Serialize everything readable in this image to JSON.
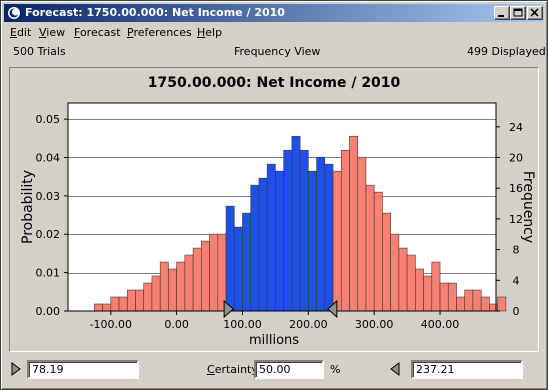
{
  "window": {
    "title": "Forecast: 1750.00.000: Net Income / 2010",
    "controls": [
      "minimize-icon",
      "maximize-icon",
      "close-icon"
    ]
  },
  "menu": {
    "edit": {
      "first": "E",
      "rest": "dit"
    },
    "view": {
      "first": "V",
      "rest": "iew"
    },
    "forecast": {
      "first": "F",
      "rest": "orecast"
    },
    "preferences": {
      "first": "P",
      "rest": "references"
    },
    "help": {
      "first": "H",
      "rest": "elp"
    }
  },
  "info": {
    "trials": "500 Trials",
    "view_name": "Frequency View",
    "displayed": "499 Displayed"
  },
  "certainty": {
    "left_value": "78.19",
    "label_first": "C",
    "label_rest": "ertainty:",
    "value": "50.00",
    "unit": "%",
    "right_value": "237.21"
  },
  "colors": {
    "in_range": "#1e4fe6",
    "out_range": "#f98073",
    "plot_bg": "#ffffff",
    "marker": "#909090"
  },
  "chart_data": {
    "type": "bar",
    "title": "1750.00.000: Net Income / 2010",
    "xlabel": "millions",
    "ylabel": "Probability",
    "y2label": "Frequency",
    "xlim": [
      -165,
      485
    ],
    "ylim": [
      0,
      0.0542
    ],
    "y2lim": [
      0,
      27.1
    ],
    "xticks": [
      -100,
      0,
      100,
      200,
      300,
      400
    ],
    "xtick_labels": [
      "-100.00",
      "0.00",
      "100.00",
      "200.00",
      "300.00",
      "400.00"
    ],
    "yticks": [
      0,
      0.01,
      0.02,
      0.03,
      0.04,
      0.05
    ],
    "ytick_labels": [
      "0.00",
      "0.01",
      "0.02",
      "0.03",
      "0.04",
      "0.05"
    ],
    "y2ticks": [
      0,
      4,
      8,
      12,
      16,
      20,
      24
    ],
    "y2tick_labels": [
      "0",
      "4",
      "8",
      "12",
      "16",
      "20",
      "24"
    ],
    "grid": true,
    "bin_start": -125,
    "bin_width": 12.5,
    "frequencies": [
      1,
      1,
      2,
      2,
      3,
      3,
      4,
      5,
      7,
      6,
      7,
      8,
      9,
      10,
      11,
      11,
      15,
      12,
      14,
      18,
      19,
      21,
      20,
      23,
      25,
      23,
      20,
      22,
      21,
      20,
      23,
      25,
      22,
      18,
      17,
      14,
      11,
      9,
      8,
      6,
      5,
      7,
      4,
      4,
      2,
      3,
      3,
      2,
      1,
      2
    ],
    "certainty_range": [
      78.19,
      237.21
    ],
    "certainty_percent": 50.0
  }
}
